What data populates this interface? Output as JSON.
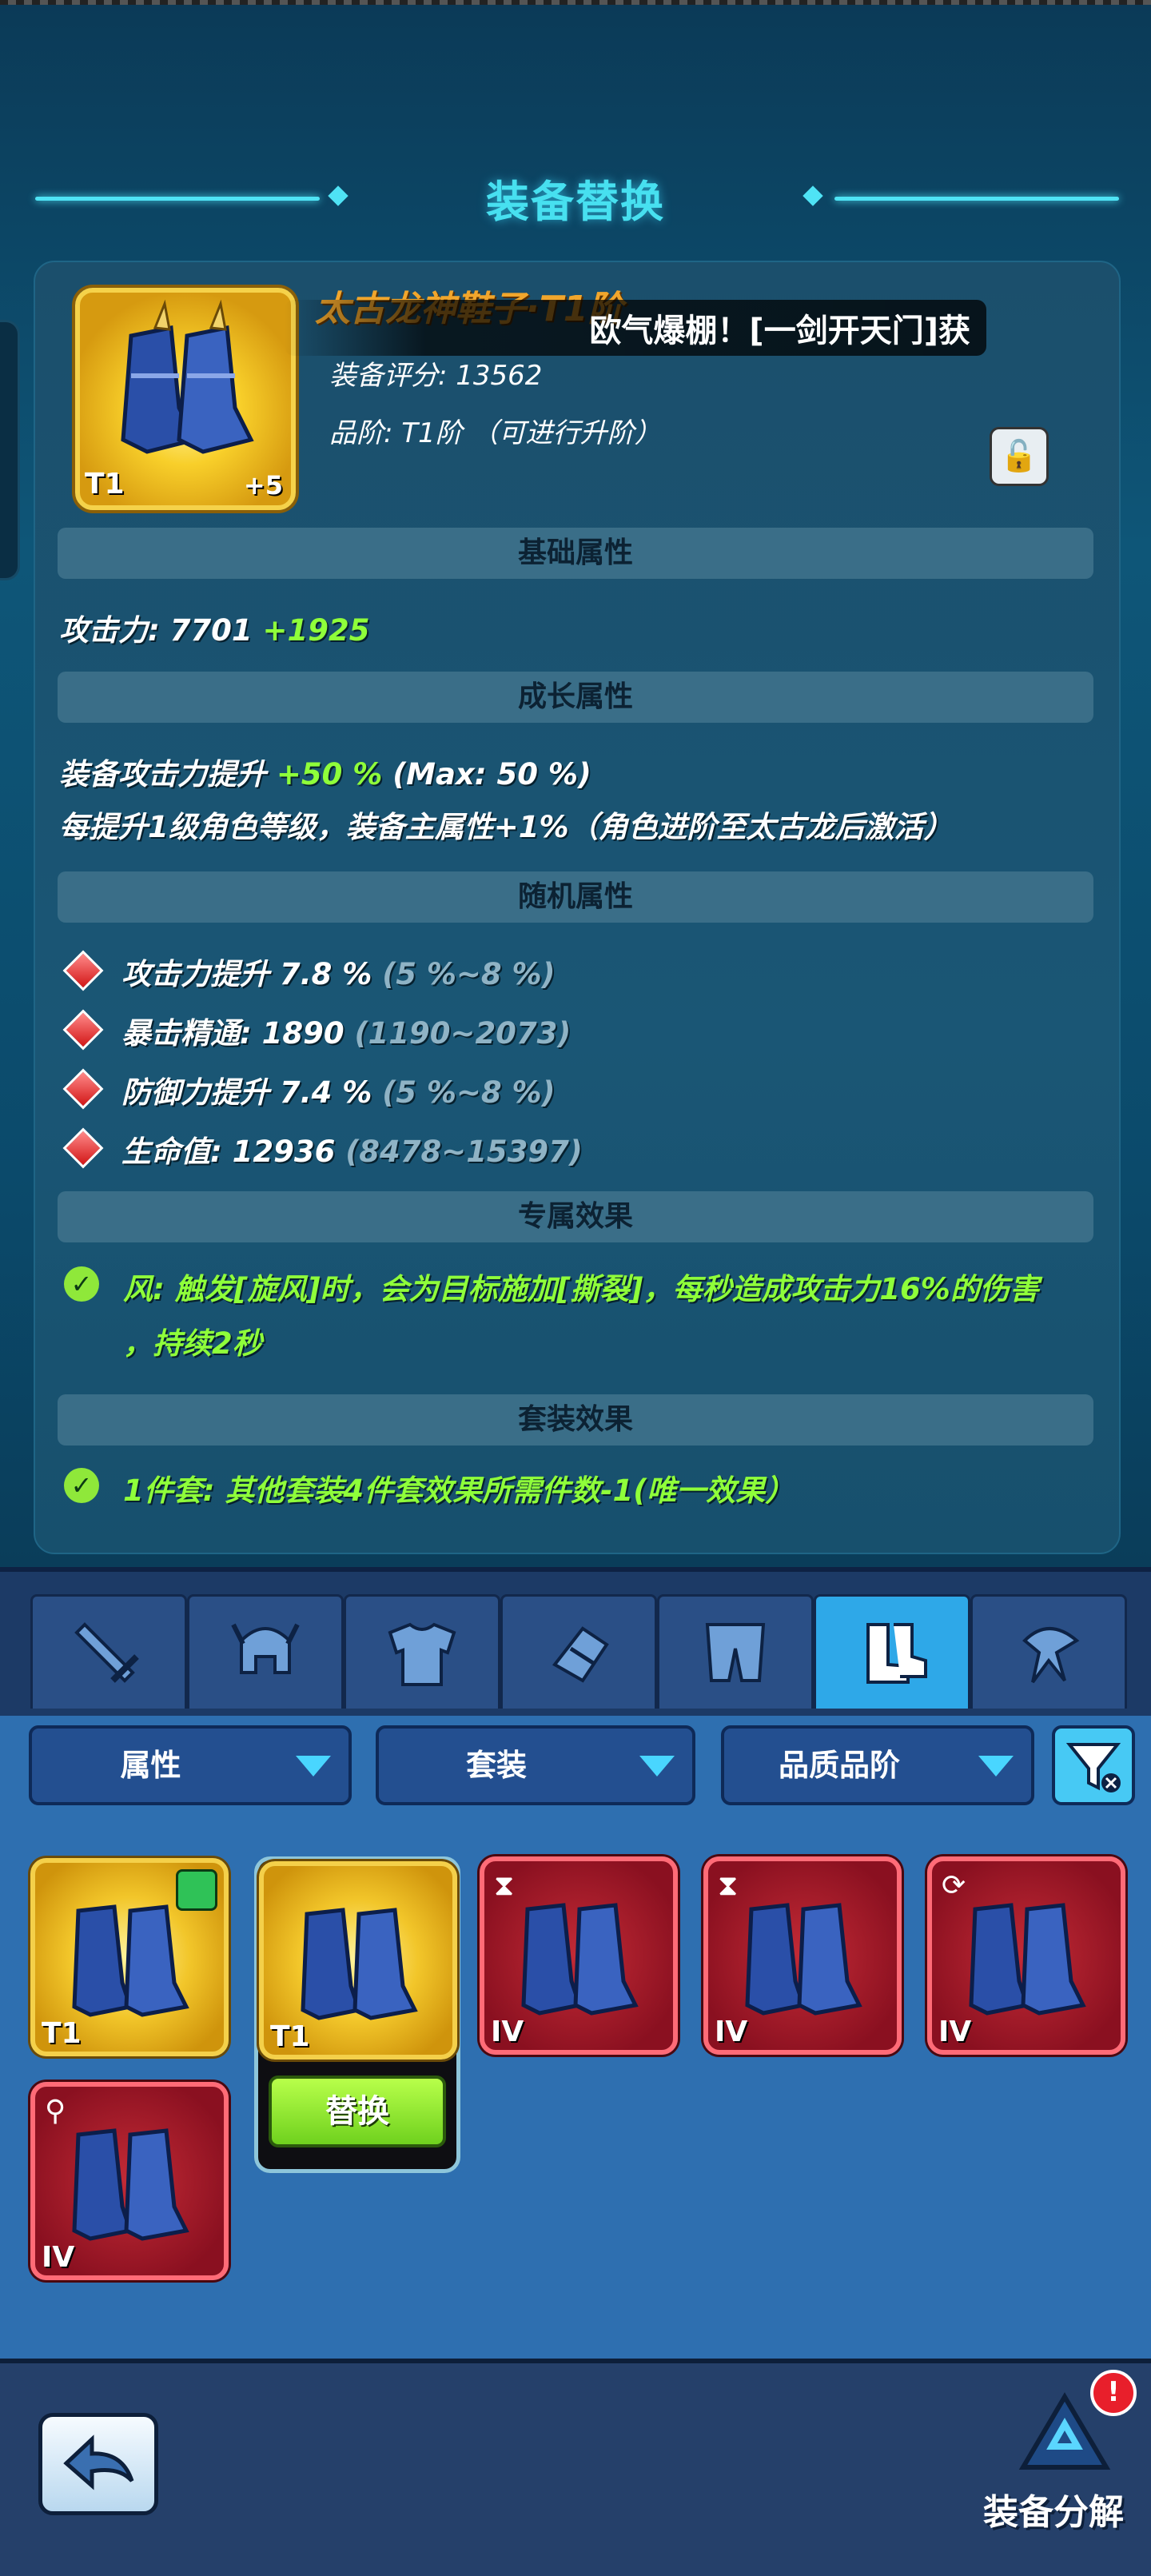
{
  "header": {
    "title": "装备替换"
  },
  "toast": {
    "text": "欧气爆棚！[一剑开天门]获"
  },
  "item": {
    "name": "太古龙神鞋子·T1阶",
    "tier_badge": "T1",
    "level_badge": "+5",
    "score_text": "装备评分: 13562",
    "grade_text": "品阶: T1阶 （可进行升阶）"
  },
  "sections": {
    "base": "基础属性",
    "growth": "成长属性",
    "random": "随机属性",
    "exclusive": "专属效果",
    "set": "套装效果"
  },
  "base_stat": {
    "label": "攻击力: 7701",
    "bonus": "+1925"
  },
  "growth": {
    "line1_label": "装备攻击力提升",
    "line1_value": "+50 %",
    "line1_max": "(Max: 50 %)",
    "line2": "每提升1级角色等级，装备主属性+1%（角色进阶至太古龙后激活）"
  },
  "random_stats": [
    {
      "label": "攻击力提升 7.8 %",
      "range": "(5 %~8 %)"
    },
    {
      "label": "暴击精通: 1890",
      "range": "(1190~2073)"
    },
    {
      "label": "防御力提升 7.4 %",
      "range": "(5 %~8 %)"
    },
    {
      "label": "生命值: 12936",
      "range": "(8478~15397)"
    }
  ],
  "exclusive": {
    "line1": "风: 触发[旋风]时，会为目标施加[撕裂]，每秒造成攻击力16%的伤害",
    "line2": "，持续2秒"
  },
  "set_effect": "1件套: 其他套装4件套效果所需件数-1(唯一效果）",
  "filters": [
    "属性",
    "套装",
    "品质品阶"
  ],
  "slots": [
    "sword",
    "helmet",
    "armor",
    "gauntlet",
    "pants",
    "boots",
    "amulet"
  ],
  "active_slot": "boots",
  "inventory": [
    {
      "grade": "T1",
      "color": "gold"
    },
    {
      "grade": "T1",
      "color": "gold",
      "replace": "替换"
    },
    {
      "grade": "IV",
      "color": "red"
    },
    {
      "grade": "IV",
      "color": "red"
    },
    {
      "grade": "IV",
      "color": "red"
    },
    {
      "grade": "IV",
      "color": "red"
    }
  ],
  "footer": {
    "dismantle_label": "装备分解",
    "alert": "!"
  },
  "colors": {
    "accent": "#47e0f0",
    "green": "#8fff3a",
    "gold": "#f1a62c"
  }
}
